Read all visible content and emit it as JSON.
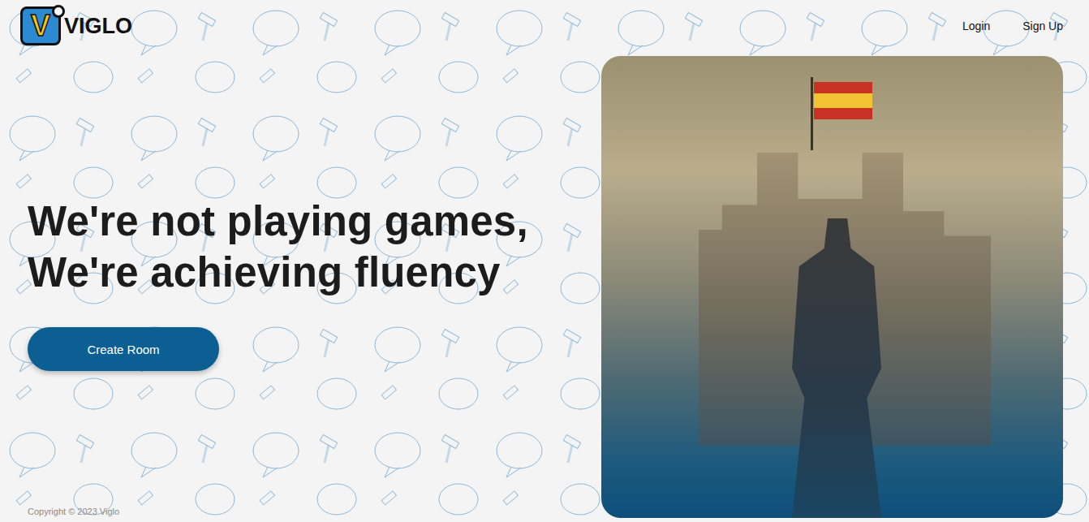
{
  "logo": {
    "letter": "V",
    "name": "VIGLO"
  },
  "nav": [
    {
      "label": "Login"
    },
    {
      "label": "Sign Up"
    }
  ],
  "hero": {
    "headline": [
      "We're not playing games,",
      "We're achieving fluency"
    ],
    "button": "Create Room"
  },
  "footer": {
    "text": "Copyright © 2023 Viglo"
  }
}
